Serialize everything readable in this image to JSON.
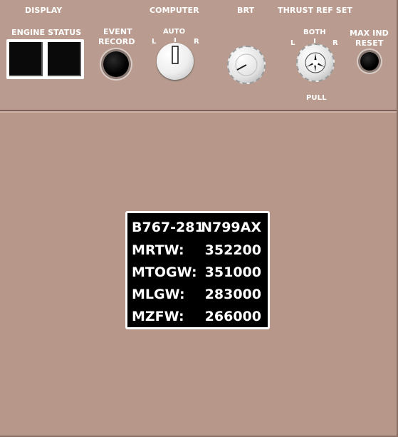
{
  "labels": {
    "display": "DISPLAY",
    "engine_status": "ENGINE STATUS",
    "event_record_1": "EVENT",
    "event_record_2": "RECORD",
    "computer": "COMPUTER",
    "auto": "AUTO",
    "computer_l": "L",
    "computer_r": "R",
    "brt": "BRT",
    "thrust_ref_set": "THRUST REF SET",
    "both": "BOTH",
    "thrust_l": "L",
    "thrust_r": "R",
    "pull": "PULL",
    "max_ind_1": "MAX IND",
    "max_ind_2": "RESET"
  },
  "placard": {
    "model": "B767-281",
    "registration": "N799AX",
    "rows": [
      {
        "label": "MRTW:",
        "value": "352200"
      },
      {
        "label": "MTOGW:",
        "value": "351000"
      },
      {
        "label": "MLGW:",
        "value": "283000"
      },
      {
        "label": "MZFW:",
        "value": "266000"
      }
    ]
  }
}
